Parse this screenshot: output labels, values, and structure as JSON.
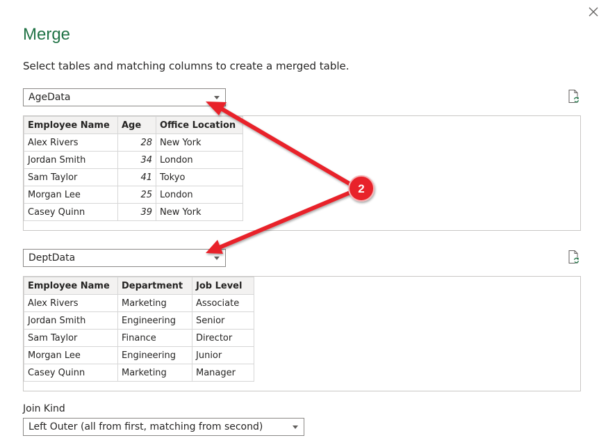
{
  "dialog": {
    "title": "Merge",
    "subtitle": "Select tables and matching columns to create a merged table."
  },
  "icons": {
    "close": "close-icon",
    "dropdown_caret": "chevron-down-icon",
    "refresh": "refresh-preview-icon"
  },
  "colors": {
    "title": "#217346",
    "annotation": "#e8222a"
  },
  "first_table": {
    "selected": "AgeData",
    "headers": [
      "Employee Name",
      "Age",
      "Office Location"
    ],
    "rows": [
      [
        "Alex Rivers",
        "28",
        "New York"
      ],
      [
        "Jordan Smith",
        "34",
        "London"
      ],
      [
        "Sam Taylor",
        "41",
        "Tokyo"
      ],
      [
        "Morgan Lee",
        "25",
        "London"
      ],
      [
        "Casey Quinn",
        "39",
        "New York"
      ]
    ]
  },
  "second_table": {
    "selected": "DeptData",
    "headers": [
      "Employee Name",
      "Department",
      "Job Level"
    ],
    "rows": [
      [
        "Alex Rivers",
        "Marketing",
        "Associate"
      ],
      [
        "Jordan Smith",
        "Engineering",
        "Senior"
      ],
      [
        "Sam Taylor",
        "Finance",
        "Director"
      ],
      [
        "Morgan Lee",
        "Engineering",
        "Junior"
      ],
      [
        "Casey Quinn",
        "Marketing",
        "Manager"
      ]
    ]
  },
  "join_kind": {
    "label": "Join Kind",
    "selected": "Left Outer (all from first, matching from second)"
  },
  "annotation": {
    "badge": "2"
  }
}
